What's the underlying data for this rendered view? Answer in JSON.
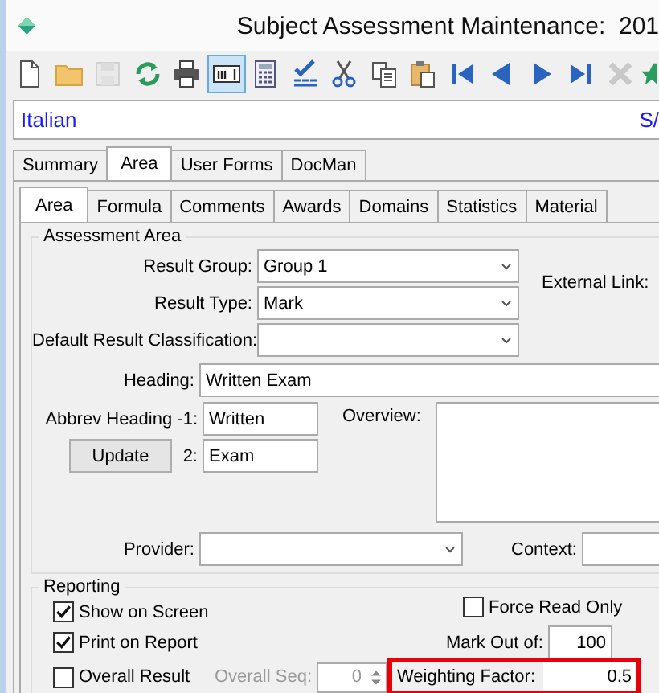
{
  "window": {
    "title": "Subject Assessment Maintenance:  201"
  },
  "toolbar": [
    {
      "selected": false,
      "disabled": false
    },
    {
      "selected": false,
      "disabled": false
    },
    {
      "selected": false,
      "disabled": true
    },
    {
      "selected": false,
      "disabled": false
    },
    {
      "selected": false,
      "disabled": false
    },
    {
      "selected": true,
      "disabled": false
    },
    {
      "selected": false,
      "disabled": false
    },
    {
      "selected": false,
      "disabled": false
    },
    {
      "selected": false,
      "disabled": false
    },
    {
      "selected": false,
      "disabled": false
    },
    {
      "selected": false,
      "disabled": false
    },
    {
      "selected": false,
      "disabled": false
    },
    {
      "selected": false,
      "disabled": false
    },
    {
      "selected": false,
      "disabled": false
    },
    {
      "selected": false,
      "disabled": false
    },
    {
      "selected": false,
      "disabled": true
    },
    {
      "selected": false,
      "disabled": false
    }
  ],
  "record": {
    "name": "Italian",
    "code": "S/"
  },
  "tabs": [
    {
      "label": "Summary",
      "selected": false
    },
    {
      "label": "Area",
      "selected": true
    },
    {
      "label": "User Forms",
      "selected": false
    },
    {
      "label": "DocMan",
      "selected": false
    }
  ],
  "subtabs": [
    {
      "label": "Area",
      "selected": true
    },
    {
      "label": "Formula",
      "selected": false
    },
    {
      "label": "Comments",
      "selected": false
    },
    {
      "label": "Awards",
      "selected": false
    },
    {
      "label": "Domains",
      "selected": false
    },
    {
      "label": "Statistics",
      "selected": false
    },
    {
      "label": "Material",
      "selected": false
    }
  ],
  "assessment_area": {
    "title": "Assessment Area",
    "result_group": {
      "label": "Result Group:",
      "value": "Group 1"
    },
    "result_type": {
      "label": "Result Type:",
      "value": "Mark"
    },
    "default_result_classification": {
      "label": "Default Result Classification:"
    },
    "external_link": {
      "label": "External Link:"
    },
    "heading": {
      "label": "Heading:",
      "value": "Written Exam"
    },
    "abbrev_heading_1": {
      "label": "Abbrev Heading -1:",
      "value": "Written"
    },
    "update_button": "Update",
    "abbrev_heading_2": {
      "label": "2:",
      "value": "Exam"
    },
    "overview": {
      "label": "Overview:"
    },
    "provider": {
      "label": "Provider:"
    },
    "context": {
      "label": "Context:"
    }
  },
  "reporting": {
    "title": "Reporting",
    "checkboxes": [
      {
        "label": "Show on Screen",
        "checked": true
      },
      {
        "label": "Print on Report",
        "checked": true
      },
      {
        "label": "Overall Result",
        "checked": false
      }
    ],
    "force_read_only": {
      "label": "Force Read Only",
      "checked": false
    },
    "mark_out_of": {
      "label": "Mark Out of:",
      "value": "100"
    },
    "overall_seq": {
      "label": "Overall Seq:",
      "value": "0",
      "disabled": true
    },
    "weighting_factor": {
      "label": "Weighting Factor:",
      "value": "0.5",
      "highlighted": true
    }
  }
}
